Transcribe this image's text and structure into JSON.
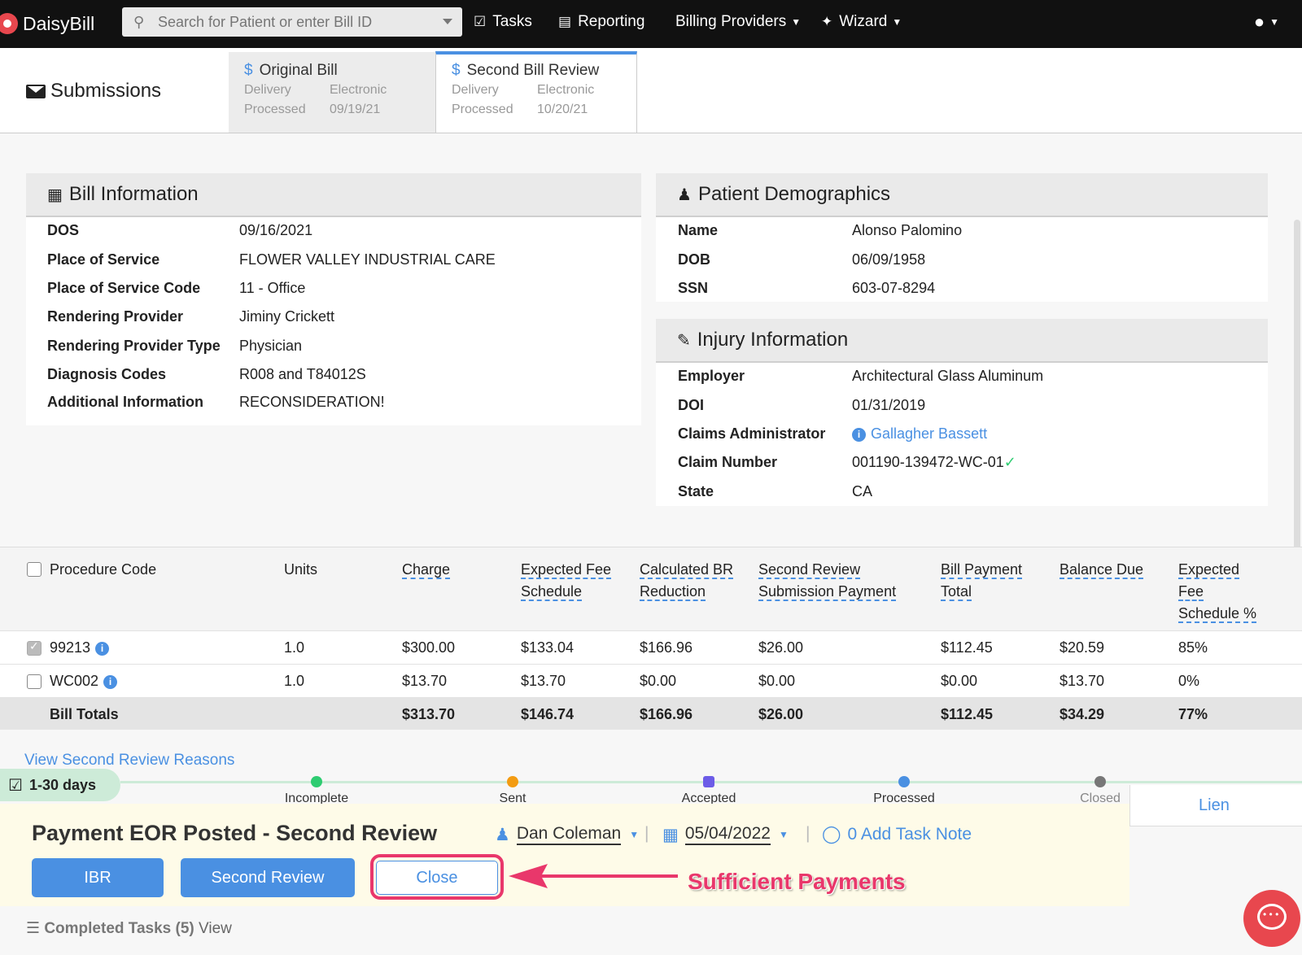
{
  "nav": {
    "brand": "DaisyBill",
    "search_placeholder": "Search for Patient or enter Bill ID",
    "tasks": "Tasks",
    "reporting": "Reporting",
    "billing_providers": "Billing Providers",
    "wizard": "Wizard"
  },
  "submissions": {
    "title": "Submissions",
    "tabs": [
      {
        "title": "Original Bill",
        "delivery_label": "Delivery",
        "delivery_value": "Electronic",
        "processed_label": "Processed",
        "processed_value": "09/19/21"
      },
      {
        "title": "Second Bill Review",
        "delivery_label": "Delivery",
        "delivery_value": "Electronic",
        "processed_label": "Processed",
        "processed_value": "10/20/21"
      }
    ]
  },
  "bill_info": {
    "title": "Bill Information",
    "rows": [
      {
        "label": "DOS",
        "value": "09/16/2021"
      },
      {
        "label": "Place of Service",
        "value": "FLOWER VALLEY INDUSTRIAL CARE"
      },
      {
        "label": "Place of Service Code",
        "value": "11 - Office"
      },
      {
        "label": "Rendering Provider",
        "value": "Jiminy Crickett"
      },
      {
        "label": "Rendering Provider Type",
        "value": "Physician"
      },
      {
        "label": "Diagnosis Codes",
        "value": "R008 and T84012S"
      },
      {
        "label": "Additional Information",
        "value": "RECONSIDERATION!"
      }
    ]
  },
  "patient": {
    "title": "Patient Demographics",
    "rows": [
      {
        "label": "Name",
        "value": "Alonso Palomino"
      },
      {
        "label": "DOB",
        "value": "06/09/1958"
      },
      {
        "label": "SSN",
        "value": "603-07-8294"
      }
    ]
  },
  "injury": {
    "title": "Injury Information",
    "rows": [
      {
        "label": "Employer",
        "value": "Architectural Glass Aluminum"
      },
      {
        "label": "DOI",
        "value": "01/31/2019"
      },
      {
        "label": "Claims Administrator",
        "value": "Gallagher Bassett"
      },
      {
        "label": "Claim Number",
        "value": "001190-139472-WC-01"
      },
      {
        "label": "State",
        "value": "CA"
      }
    ]
  },
  "table": {
    "headers": {
      "procedure_code": "Procedure Code",
      "units": "Units",
      "charge": "Charge",
      "expected_fee_1": "Expected Fee",
      "expected_fee_2": "Schedule",
      "calc_br_1": "Calculated BR",
      "calc_br_2": "Reduction",
      "second_review_1": "Second Review",
      "second_review_2": "Submission Payment",
      "bill_payment_1": "Bill Payment",
      "bill_payment_2": "Total",
      "balance_due": "Balance Due",
      "efs_pct_1": "Expected",
      "efs_pct_2": "Fee",
      "efs_pct_3": "Schedule %"
    },
    "rows": [
      {
        "code": "99213",
        "units": "1.0",
        "charge": "$300.00",
        "efs": "$133.04",
        "br": "$166.96",
        "srp": "$26.00",
        "bpt": "$112.45",
        "balance": "$20.59",
        "pct": "85%"
      },
      {
        "code": "WC002",
        "units": "1.0",
        "charge": "$13.70",
        "efs": "$13.70",
        "br": "$0.00",
        "srp": "$0.00",
        "bpt": "$0.00",
        "balance": "$13.70",
        "pct": "0%"
      }
    ],
    "totals": {
      "label": "Bill Totals",
      "charge": "$313.70",
      "efs": "$146.74",
      "br": "$166.96",
      "srp": "$26.00",
      "bpt": "$112.45",
      "balance": "$34.29",
      "pct": "77%"
    }
  },
  "task": {
    "review_link": "View Second Review Reasons",
    "days_badge": "1-30 days",
    "stages": [
      "Incomplete",
      "Sent",
      "Accepted",
      "Processed",
      "Closed"
    ],
    "lien_tab": "Lien",
    "title": "Payment EOR Posted - Second Review",
    "assignee": "Dan Coleman",
    "date": "05/04/2022",
    "note_link": "0 Add Task Note",
    "buttons": {
      "ibr": "IBR",
      "second_review": "Second Review",
      "close": "Close"
    },
    "annotation": "Sufficient Payments",
    "completed_label": "Completed Tasks (5)",
    "completed_view": "View"
  },
  "colors": {
    "accent": "#4a90e2",
    "annotation": "#e9376b",
    "brand": "#e8474e"
  }
}
